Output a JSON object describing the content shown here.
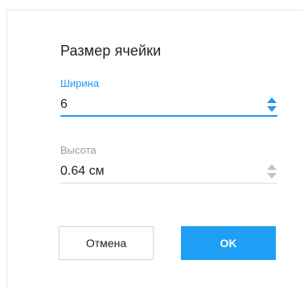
{
  "dialog": {
    "title": "Размер ячейки",
    "width_field": {
      "label": "Ширина",
      "value": "6",
      "state": "focused"
    },
    "height_field": {
      "label": "Высота",
      "value": "0.64 см"
    },
    "buttons": {
      "cancel_label": "Отмена",
      "ok_label": "OK"
    }
  },
  "colors": {
    "accent": "#2196f3",
    "ok_button_bg": "#1e9ef5",
    "muted_label": "#9a9a9a",
    "text": "#222222"
  },
  "icons": {
    "spinner_up": "caret-up-icon",
    "spinner_down": "caret-down-icon"
  }
}
